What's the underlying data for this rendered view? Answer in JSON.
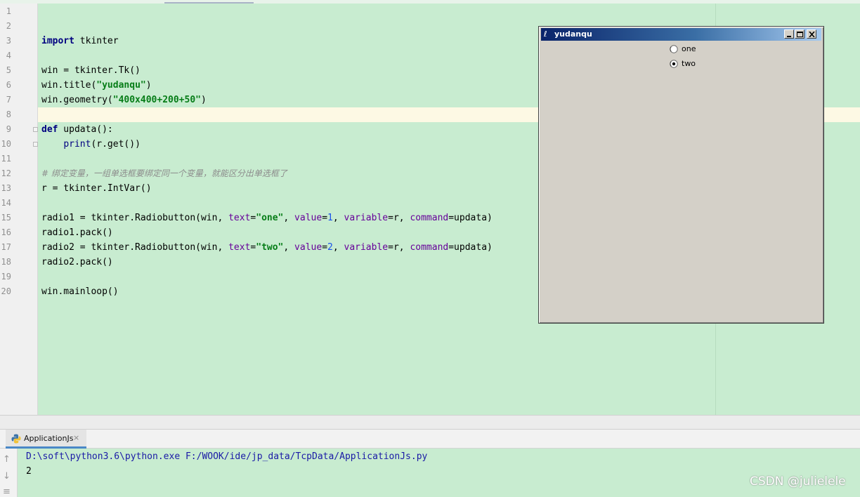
{
  "editor": {
    "line_numbers": [
      "1",
      "2",
      "3",
      "4",
      "5",
      "6",
      "7",
      "8",
      "9",
      "10",
      "11",
      "12",
      "13",
      "14",
      "15",
      "16",
      "17",
      "18",
      "19",
      "20"
    ],
    "code": {
      "import_kw": "import",
      "import_mod": " tkinter",
      "l5": "win = tkinter.Tk()",
      "l6_a": "win.title(",
      "l6_str": "\"yudanqu\"",
      "l6_b": ")",
      "l7_a": "win.geometry(",
      "l7_str": "\"400x400+200+50\"",
      "l7_b": ")",
      "def_kw": "def",
      "def_rest": " updata():",
      "l10_indent": "    ",
      "l10_print": "print",
      "l10_rest": "(r.get())",
      "l12_comment": "# 绑定变量，一组单选框要绑定同一个变量，就能区分出单选框了",
      "l13": "r = tkinter.IntVar()",
      "l15_a": "radio1 = tkinter.Radiobutton(win, ",
      "l15_text": "text",
      "l15_eq1": "=",
      "l15_str": "\"one\"",
      "l15_c1": ", ",
      "l15_value": "value",
      "l15_eq2": "=",
      "l15_num": "1",
      "l15_c2": ", ",
      "l15_variable": "variable",
      "l15_eq3": "=r, ",
      "l15_command": "command",
      "l15_end": "=updata)",
      "l16": "radio1.pack()",
      "l17_a": "radio2 = tkinter.Radiobutton(win, ",
      "l17_text": "text",
      "l17_eq1": "=",
      "l17_str": "\"two\"",
      "l17_c1": ", ",
      "l17_value": "value",
      "l17_eq2": "=",
      "l17_num": "2",
      "l17_c2": ", ",
      "l17_variable": "variable",
      "l17_eq3": "=r, ",
      "l17_command": "command",
      "l17_end": "=updata)",
      "l18": "radio2.pack()",
      "l20": "win.mainloop()"
    }
  },
  "tk_window": {
    "title": "yudanqu",
    "feather": "ℓ",
    "radio_one_label": "one",
    "radio_two_label": "two",
    "selected": "two"
  },
  "run_panel": {
    "tab_label": "ApplicationJs",
    "tab_close": "×",
    "up_arrow": "↑",
    "down_arrow": "↓",
    "menu_glyph": "≡",
    "command_line": "D:\\soft\\python3.6\\python.exe F:/WOOK/ide/jp_data/TcpData/ApplicationJs.py",
    "output": "2"
  },
  "watermark": "CSDN @julielele",
  "colors": {
    "editor_bg": "#c8ecd0",
    "current_line": "#fdf9e4",
    "keyword": "#000080",
    "string": "#067d17",
    "param": "#660099",
    "number": "#1750eb",
    "comment": "#8c8c8c",
    "console_path": "#1a1aa6",
    "titlebar_start": "#0a246a",
    "titlebar_end": "#a6caf0"
  },
  "icons": [
    "python-file-icon",
    "close-icon",
    "scroll-up-icon",
    "scroll-down-icon",
    "menu-icon",
    "tk-feather-icon",
    "minimize-icon",
    "maximize-icon",
    "window-close-icon",
    "radio-unchecked-icon",
    "radio-checked-icon"
  ]
}
